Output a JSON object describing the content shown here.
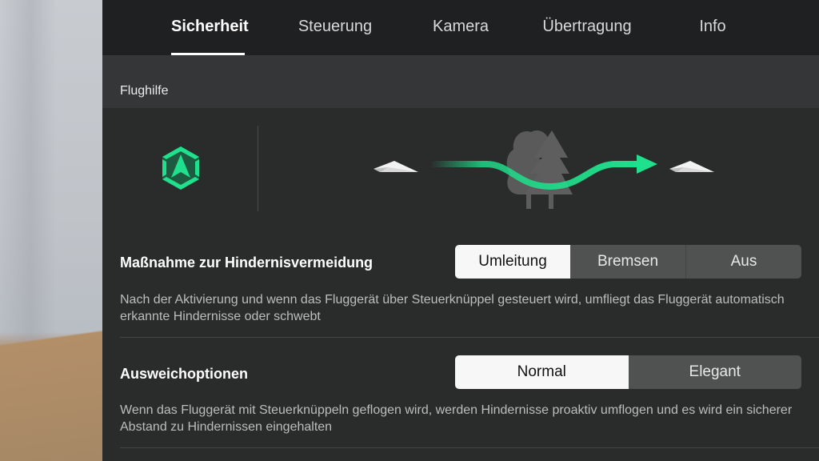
{
  "tabs": [
    {
      "label": "Sicherheit",
      "active": true
    },
    {
      "label": "Steuerung",
      "active": false
    },
    {
      "label": "Kamera",
      "active": false
    },
    {
      "label": "Übertragung",
      "active": false
    },
    {
      "label": "Info",
      "active": false
    }
  ],
  "section": {
    "title": "Flughilfe",
    "mode_icon": "obstacle-avoidance-hexagon-icon",
    "illustration": {
      "start_icon": "paper-plane-icon",
      "obstacle_icon": "trees-icon",
      "path_icon": "bypass-arrow-icon",
      "end_icon": "paper-plane-icon"
    }
  },
  "colors": {
    "accent": "#1fe08c",
    "tab_bg": "#1f2021",
    "panel_bg": "#2a2b2b",
    "header_bg": "#353637",
    "segment_selected": "#f7f7f7",
    "segment_unselected": "#505151"
  },
  "obstacle_action": {
    "title": "Maßnahme zur Hindernisvermeidung",
    "options": [
      "Umleitung",
      "Bremsen",
      "Aus"
    ],
    "selected": "Umleitung",
    "description": "Nach der Aktivierung und wenn das Fluggerät über Steuerknüppel gesteuert wird, umfliegt das Fluggerät automatisch erkannte Hindernisse oder schwebt"
  },
  "bypass_options": {
    "title": "Ausweichoptionen",
    "options": [
      "Normal",
      "Elegant"
    ],
    "selected": "Normal",
    "description": "Wenn das Fluggerät mit Steuerknüppeln geflogen wird, werden Hindernisse proaktiv umflogen und es wird ein sicherer Abstand zu Hindernissen eingehalten"
  }
}
